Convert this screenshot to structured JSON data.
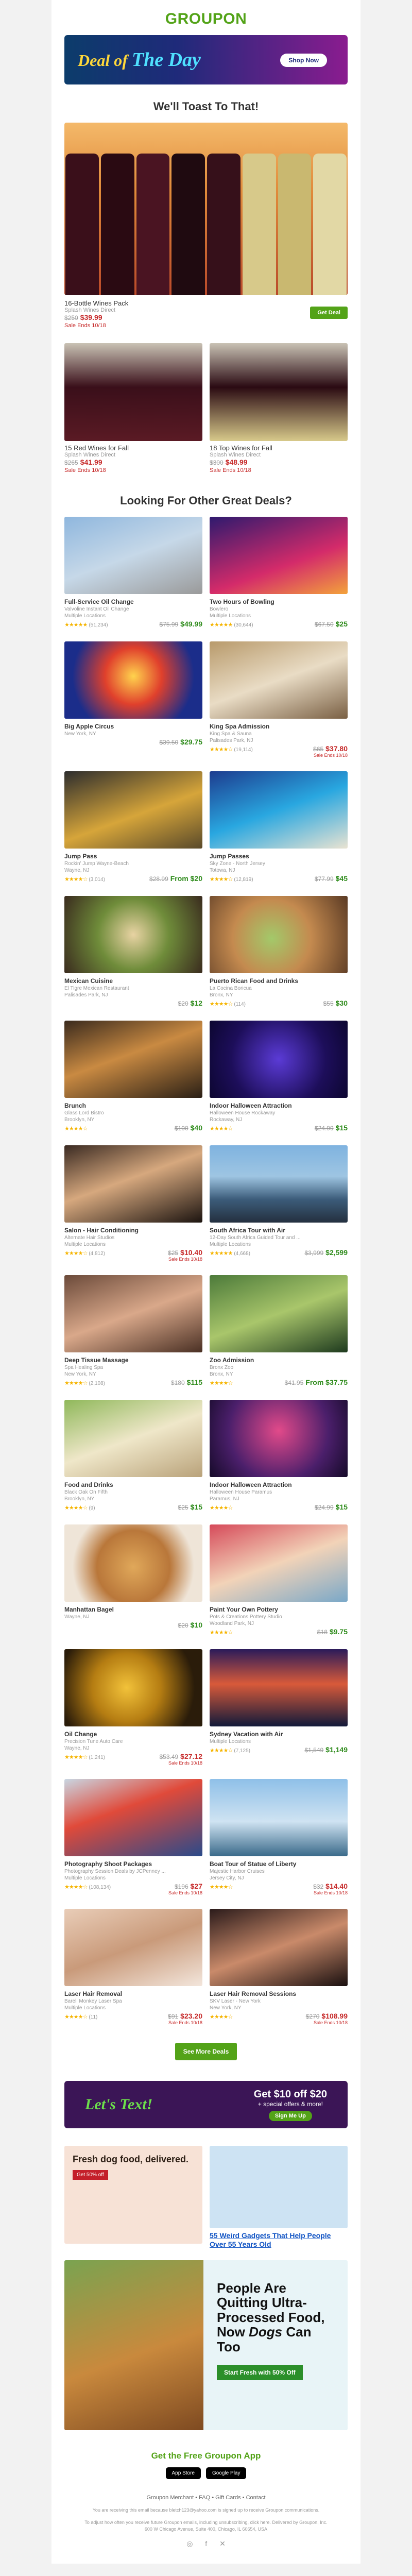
{
  "logo": "GROUPON",
  "banner": {
    "text1": "Deal of",
    "text2": "The Day",
    "button": "Shop Now"
  },
  "toast_heading": "We'll Toast To That!",
  "hero": {
    "title": "16-Bottle Wines Pack",
    "subtitle": "Splash Wines Direct",
    "orig": "$250",
    "price": "$39.99",
    "ends": "Sale Ends 10/18",
    "button": "Get Deal"
  },
  "wine_deals": [
    {
      "title": "15 Red Wines for Fall",
      "subtitle": "Splash Wines Direct",
      "orig": "$265",
      "price": "$41.99",
      "ends": "Sale Ends 10/18"
    },
    {
      "title": "18 Top Wines for Fall",
      "subtitle": "Splash Wines Direct",
      "orig": "$300",
      "price": "$48.99",
      "ends": "Sale Ends 10/18"
    }
  ],
  "other_heading": "Looking For Other Great Deals?",
  "deals": [
    {
      "title": "Full-Service Oil Change",
      "merchant": "Valvoline Instant Oil Change",
      "loc": "Multiple Locations",
      "stars": "★★★★★",
      "count": "(51,234)",
      "orig": "$75.99",
      "price": "$49.99",
      "note": "",
      "bg": "linear-gradient(160deg,#8fb7de,#c6d8e8 50%,#9a9a9a)"
    },
    {
      "title": "Two Hours of Bowling",
      "merchant": "Bowlero",
      "loc": "Multiple Locations",
      "stars": "★★★★★",
      "count": "(30,644)",
      "orig": "$67.50",
      "price": "$25",
      "note": "",
      "bg": "linear-gradient(160deg,#2e1a6e,#d42b6a 60%,#f3a23b)"
    },
    {
      "title": "Big Apple Circus",
      "merchant": "",
      "loc": "New York, NY",
      "stars": "",
      "count": "",
      "orig": "$39.50",
      "price": "$29.75",
      "note": "",
      "bg": "radial-gradient(circle at 50% 45%,#ffd34d,#e0402c 35%,#1b2d8a 75%)"
    },
    {
      "title": "King Spa Admission",
      "merchant": "King Spa & Sauna",
      "loc": "Palisades Park, NJ",
      "stars": "★★★★☆",
      "count": "(19,114)",
      "orig": "$65",
      "price": "$37.80",
      "note": "Sale Ends 10/18",
      "bg": "linear-gradient(160deg,#b89a6b,#e9dcc5 50%,#7a6044)"
    },
    {
      "title": "Jump Pass",
      "merchant": "Rockin' Jump Wayne-Beach",
      "loc": "Wayne, NJ",
      "stars": "★★★★☆",
      "count": "(3,014)",
      "orig": "$28.99",
      "price": "From $20",
      "note": "",
      "bg": "linear-gradient(160deg,#2d2d2d,#d6a53a 55%,#5a4a2a)"
    },
    {
      "title": "Jump Passes",
      "merchant": "Sky Zone - North Jersey",
      "loc": "Totowa, NJ",
      "stars": "★★★★☆",
      "count": "(12,819)",
      "orig": "$77.99",
      "price": "$45",
      "note": "",
      "bg": "linear-gradient(160deg,#1d3c8f,#29a7e0 50%,#e9e3d2)"
    },
    {
      "title": "Mexican Cuisine",
      "merchant": "El Tigre Mexican Restaurant",
      "loc": "Palisades Park, NJ",
      "stars": "",
      "count": "",
      "orig": "$20",
      "price": "$12",
      "note": "",
      "bg": "radial-gradient(circle at 50% 50%,#e8d3a3,#6f8c3a 45%,#3a2b1e)"
    },
    {
      "title": "Puerto Rican Food and Drinks",
      "merchant": "La Cocina Boricua",
      "loc": "Bronx, NY",
      "stars": "★★★★☆",
      "count": "(114)",
      "orig": "$55",
      "price": "$30",
      "note": "",
      "bg": "radial-gradient(circle at 45% 55%,#a3c96a,#c48a4f 45%,#5a3a24)"
    },
    {
      "title": "Brunch",
      "merchant": "Glass Lord Bistro",
      "loc": "Brooklyn, NY",
      "stars": "★★★★☆",
      "count": "",
      "orig": "$100",
      "price": "$40",
      "note": "",
      "bg": "linear-gradient(160deg,#3a2a1d,#c98a42 45%,#2a1f15)"
    },
    {
      "title": "Indoor Halloween Attraction",
      "merchant": "Halloween House Rockaway",
      "loc": "Rockaway, NJ",
      "stars": "★★★★☆",
      "count": "",
      "orig": "$24.99",
      "price": "$15",
      "note": "",
      "bg": "radial-gradient(circle at 50% 50%,#5b3bd6,#1d0e5a 60%,#0c0630)"
    },
    {
      "title": "Salon - Hair Conditioning",
      "merchant": "Alternate Hair Studios",
      "loc": "Multiple Locations",
      "stars": "★★★★☆",
      "count": "(4,812)",
      "orig": "$25",
      "price": "$10.40",
      "note": "Sale Ends 10/18",
      "bg": "linear-gradient(160deg,#3a2a22,#d6a87e 45%,#1c1410)"
    },
    {
      "title": "South Africa Tour with Air",
      "merchant": "12-Day South Africa Guided Tour and ...",
      "loc": "Multiple Locations",
      "stars": "★★★★★",
      "count": "(4,668)",
      "orig": "$3,999",
      "price": "$2,599",
      "note": "",
      "bg": "linear-gradient(180deg,#7fb3e0,#9ec5e2 40%,#3c5c7a 70%,#24303f)"
    },
    {
      "title": "Deep Tissue Massage",
      "merchant": "Spa Healing Spa",
      "loc": "New York, NY",
      "stars": "★★★★☆",
      "count": "(2,108)",
      "orig": "$180",
      "price": "$115",
      "note": "",
      "bg": "linear-gradient(160deg,#6b4a3a,#d9a88a 50%,#4a3024)"
    },
    {
      "title": "Zoo Admission",
      "merchant": "Bronx Zoo",
      "loc": "Bronx, NY",
      "stars": "★★★★☆",
      "count": "",
      "orig": "$41.95",
      "price": "From $37.75",
      "note": "",
      "bg": "linear-gradient(160deg,#4c7a3a,#a9c66b 50%,#1e3a1e)"
    },
    {
      "title": "Food and Drinks",
      "merchant": "Black Oak On Fifth",
      "loc": "Brooklyn, NY",
      "stars": "★★★★☆",
      "count": "(9)",
      "orig": "$25",
      "price": "$15",
      "note": "",
      "bg": "linear-gradient(160deg,#8fb85a,#efe7c9 50%,#b9a27a)"
    },
    {
      "title": "Indoor Halloween Attraction",
      "merchant": "Halloween House Paramus",
      "loc": "Paramus, NJ",
      "stars": "★★★★☆",
      "count": "",
      "orig": "$24.99",
      "price": "$15",
      "note": "",
      "bg": "radial-gradient(circle at 50% 40%,#e24a8a,#4b1f6b 60%,#150a28)"
    },
    {
      "title": "Manhattan Bagel",
      "merchant": "",
      "loc": "Wayne, NJ",
      "stars": "",
      "count": "",
      "orig": "$20",
      "price": "$10",
      "note": "",
      "bg": "radial-gradient(circle at 50% 55%,#e0a85a,#b9773a 45%,#efe5d8 75%)"
    },
    {
      "title": "Paint Your Own Pottery",
      "merchant": "Pots & Creations Pottery Studio",
      "loc": "Woodland Park, NJ",
      "stars": "★★★★☆",
      "count": "",
      "orig": "$18",
      "price": "$9.75",
      "note": "",
      "bg": "linear-gradient(160deg,#d64a5a,#f2d3b8 50%,#7aa8c8)"
    },
    {
      "title": "Oil Change",
      "merchant": "Precision Tune Auto Care",
      "loc": "Wayne, NJ",
      "stars": "★★★★☆",
      "count": "(1,241)",
      "orig": "$53.49",
      "price": "$27.12",
      "note": "Sale Ends 10/18",
      "bg": "radial-gradient(circle at 45% 50%,#f2c23a,#b57d12 40%,#2a1c0a 80%)"
    },
    {
      "title": "Sydney Vacation with Air",
      "merchant": "",
      "loc": "Multiple Locations",
      "stars": "★★★★☆",
      "count": "(7,125)",
      "orig": "$1,549",
      "price": "$1,149",
      "note": "",
      "bg": "linear-gradient(180deg,#2b1b5a,#d85a3a 45%,#111a3a)"
    },
    {
      "title": "Photography Shoot Packages",
      "merchant": "Photography Session Deals by JCPenney ...",
      "loc": "Multiple Locations",
      "stars": "★★★★☆",
      "count": "(108,134)",
      "orig": "$196",
      "price": "$27",
      "note": "Sale Ends 10/18",
      "bg": "linear-gradient(160deg,#c9d6e2,#e04a3a 40%,#2a4a8a)"
    },
    {
      "title": "Boat Tour of Statue of Liberty",
      "merchant": "Majestic Harbor Cruises",
      "loc": "Jersey City, NJ",
      "stars": "★★★★☆",
      "count": "",
      "orig": "$32",
      "price": "$14.40",
      "note": "Sale Ends 10/18",
      "bg": "linear-gradient(180deg,#8fc0e8,#cfe3f2 55%,#3a6a8a)"
    },
    {
      "title": "Laser Hair Removal",
      "merchant": "Bareli Monkey Laser Spa",
      "loc": "Multiple Locations",
      "stars": "★★★★☆",
      "count": "(11)",
      "orig": "$91",
      "price": "$23.20",
      "note": "Sale Ends 10/18",
      "bg": "linear-gradient(160deg,#e9cdb8,#c99a7a 50%,#f3e6dc)"
    },
    {
      "title": "Laser Hair Removal Sessions",
      "merchant": "SKV Laser - New York",
      "loc": "New York, NY",
      "stars": "★★★★☆",
      "count": "",
      "orig": "$270",
      "price": "$108.99",
      "note": "Sale Ends 10/18",
      "bg": "linear-gradient(160deg,#2a1a1a,#c98a6a 50%,#1a1010)"
    }
  ],
  "see_more": "See More Deals",
  "text_banner": {
    "lets_text": "Let's Text!",
    "get": "Get $10 off $20",
    "sub": "+ special offers & more!",
    "sign": "Sign Me Up"
  },
  "ads": {
    "ad1_text": "Fresh dog food, delivered.",
    "ad1_button": "Get 50% off",
    "ad2_caption": "55 Weird Gadgets That Help People Over 55 Years Old",
    "big_headline_1": "People Are Quitting Ultra-Processed Food, Now",
    "big_headline_2": "Dogs",
    "big_headline_3": "Can Too",
    "big_button": "Start Fresh with 50% Off"
  },
  "app": {
    "title": "Get the Free Groupon App",
    "ios": "App Store",
    "android": "Google Play"
  },
  "footer": {
    "links": "Groupon Merchant  •  FAQ  •  Gift Cards  •  Contact",
    "legal1": "You are receiving this email because bletch123@yahoo.com is signed up to receive Groupon communications.",
    "legal2": "To adjust how often you receive future Groupon emails, including unsubscribing, click here. Delivered by Groupon, Inc. 600 W Chicago Avenue, Suite 400, Chicago, IL 60654, USA"
  },
  "colors": {
    "brand_green": "#53a318",
    "sale_red": "#c62828"
  }
}
